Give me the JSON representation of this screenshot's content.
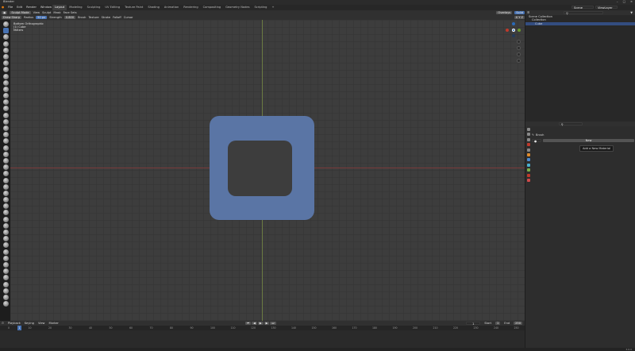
{
  "app": {
    "title": "Blender"
  },
  "menus": [
    "File",
    "Edit",
    "Render",
    "Window",
    "Help"
  ],
  "workspace_tabs": [
    {
      "label": "Layout",
      "active": true
    },
    {
      "label": "Modeling",
      "active": false
    },
    {
      "label": "Sculpting",
      "active": false
    },
    {
      "label": "UV Editing",
      "active": false
    },
    {
      "label": "Texture Paint",
      "active": false
    },
    {
      "label": "Shading",
      "active": false
    },
    {
      "label": "Animation",
      "active": false
    },
    {
      "label": "Rendering",
      "active": false
    },
    {
      "label": "Compositing",
      "active": false
    },
    {
      "label": "Geometry Nodes",
      "active": false
    },
    {
      "label": "Scripting",
      "active": false
    }
  ],
  "scene": {
    "scene_name": "Scene",
    "view_layer": "ViewLayer"
  },
  "viewport_header": {
    "mode": "Sculpt Mode",
    "menus": [
      "View",
      "Sculpt",
      "Mask",
      "Face Sets"
    ],
    "overlay_label": "Overlays",
    "shading_label": "Solid"
  },
  "tool_header": {
    "brush_name": "Draw Sharp",
    "radius_label": "Radius",
    "radius_value": "50 px",
    "strength_label": "Strength",
    "strength_value": "0.800",
    "menus": [
      "Brush",
      "Texture",
      "Stroke",
      "Falloff",
      "Cursor"
    ],
    "direction": "+",
    "symmetry": "X Y Z"
  },
  "viewport_info": {
    "line1": "Bottom Orthographic",
    "line2": "(1) Cube",
    "line3": "Meters"
  },
  "outliner": {
    "rows": [
      {
        "label": "Scene Collection",
        "selected": false
      },
      {
        "label": "Collection",
        "selected": false
      },
      {
        "label": "Cube",
        "selected": true
      }
    ]
  },
  "properties": {
    "section": "Brush",
    "new_label": "New",
    "tooltip": "Add a New Material"
  },
  "timeline": {
    "menus": [
      "Playback",
      "Keying",
      "View",
      "Marker"
    ],
    "current_frame": "1",
    "start_label": "Start",
    "start_value": "1",
    "end_label": "End",
    "end_value": "250",
    "ticks": [
      "0",
      "10",
      "20",
      "30",
      "40",
      "50",
      "60",
      "70",
      "80",
      "90",
      "100",
      "110",
      "120",
      "130",
      "140",
      "150",
      "160",
      "170",
      "180",
      "190",
      "200",
      "210",
      "220",
      "230",
      "240",
      "250"
    ]
  },
  "colors": {
    "accent": "#4772b3",
    "mesh": "#5a75a5",
    "x_axis": "#c0392b",
    "y_axis": "#6a9a2a",
    "z_axis": "#2a6ab8"
  },
  "status": {
    "version": "3.6.0"
  }
}
